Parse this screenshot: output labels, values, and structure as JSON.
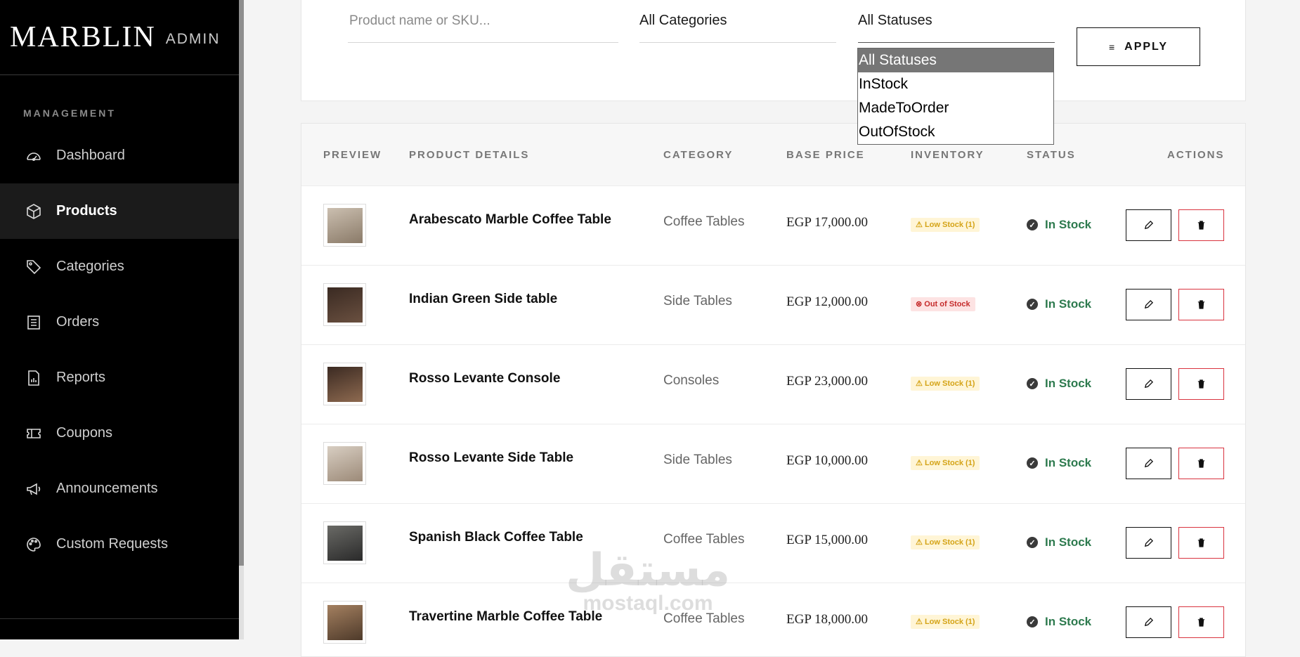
{
  "brand": {
    "logo": "MARBLIN",
    "sub": "ADMIN"
  },
  "sidebar": {
    "section_label": "MANAGEMENT",
    "items": [
      {
        "label": "Dashboard",
        "icon": "dashboard-gauge-icon",
        "active": false
      },
      {
        "label": "Products",
        "icon": "box-icon",
        "active": true
      },
      {
        "label": "Categories",
        "icon": "tag-icon",
        "active": false
      },
      {
        "label": "Orders",
        "icon": "receipt-icon",
        "active": false
      },
      {
        "label": "Reports",
        "icon": "report-chart-icon",
        "active": false
      },
      {
        "label": "Coupons",
        "icon": "ticket-icon",
        "active": false
      },
      {
        "label": "Announcements",
        "icon": "megaphone-icon",
        "active": false
      },
      {
        "label": "Custom Requests",
        "icon": "palette-icon",
        "active": false
      }
    ]
  },
  "filters": {
    "search_placeholder": "Product name or SKU...",
    "category_value": "All Categories",
    "status_value": "All Statuses",
    "status_options": [
      "All Statuses",
      "InStock",
      "MadeToOrder",
      "OutOfStock"
    ],
    "apply_label": "APPLY"
  },
  "table": {
    "headers": {
      "preview": "PREVIEW",
      "details": "PRODUCT DETAILS",
      "category": "CATEGORY",
      "price": "BASE PRICE",
      "inventory": "INVENTORY",
      "status": "STATUS",
      "actions": "ACTIONS"
    },
    "rows": [
      {
        "name": "Arabescato Marble Coffee Table",
        "category": "Coffee Tables",
        "price": "EGP 17,000.00",
        "inventory": "Low Stock (1)",
        "inventory_type": "low",
        "status": "In Stock"
      },
      {
        "name": "Indian Green Side table",
        "category": "Side Tables",
        "price": "EGP 12,000.00",
        "inventory": "Out of Stock",
        "inventory_type": "out",
        "status": "In Stock"
      },
      {
        "name": "Rosso Levante Console",
        "category": "Consoles",
        "price": "EGP 23,000.00",
        "inventory": "Low Stock (1)",
        "inventory_type": "low",
        "status": "In Stock"
      },
      {
        "name": "Rosso Levante Side Table",
        "category": "Side Tables",
        "price": "EGP 10,000.00",
        "inventory": "Low Stock (1)",
        "inventory_type": "low",
        "status": "In Stock"
      },
      {
        "name": "Spanish Black Coffee Table",
        "category": "Coffee Tables",
        "price": "EGP 15,000.00",
        "inventory": "Low Stock (1)",
        "inventory_type": "low",
        "status": "In Stock"
      },
      {
        "name": "Travertine Marble Coffee Table",
        "category": "Coffee Tables",
        "price": "EGP 18,000.00",
        "inventory": "Low Stock (1)",
        "inventory_type": "low",
        "status": "In Stock"
      }
    ]
  },
  "watermark": {
    "arabic": "مستقل",
    "latin": "mostaql.com"
  },
  "colors": {
    "sidebar_bg": "#000000",
    "in_stock": "#2d7a4e",
    "low_stock": "#d4a316",
    "out_of_stock": "#c52b2b",
    "delete": "#d9333f"
  }
}
